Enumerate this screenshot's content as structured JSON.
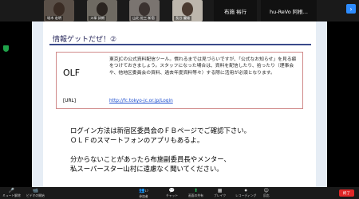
{
  "participants": [
    {
      "name": "堀木 宏明"
    },
    {
      "name": "ス塚 詳朗"
    },
    {
      "name": "山北 佐三 新宿"
    },
    {
      "name": "長谷 優雄"
    }
  ],
  "name_tiles": [
    "布施 裕行",
    "hu-ReVo 阿根..."
  ],
  "slide": {
    "title": "情報ゲットだぜ！②",
    "olf_label": "OLF",
    "olf_description": "東京JCの公式資料配信ツール。慣れるまでは見づらいですが、「公式なお知らせ」を見る癖をつけておきましょう。スタッフになった場合は、資料を配信したり、拾ったり（理事会や、他地区委員会の資料、過去年度資料等々）する際に活用が必須となります。",
    "url_label": "[URL]",
    "url": "http://fc.tokyo-jc.or.jp/Login",
    "body_lines": [
      "ログイン方法は新宿区委員会のＦＢページでご確認下さい。",
      "ＯＬＦのスマートフォンのアプリもあるよ。",
      "分からないことがあったら布施副委員長やメンター、",
      "私スーパースター山村に遠慮なく聞いてください。"
    ]
  },
  "toolbar": {
    "items": [
      {
        "label": "ミュート解除",
        "icon": "🎤"
      },
      {
        "label": "ビデオの開始",
        "icon": "📹"
      },
      {
        "label": "参加者",
        "icon": "👥"
      },
      {
        "label": "チャット",
        "icon": "💬"
      },
      {
        "label": "画面の共有",
        "icon": "⬆"
      },
      {
        "label": "ブレイク",
        "icon": "▦"
      },
      {
        "label": "レコーディング",
        "icon": "⏺"
      },
      {
        "label": "反応",
        "icon": "☺"
      }
    ],
    "participants_count": "17",
    "end_label": "終了"
  }
}
